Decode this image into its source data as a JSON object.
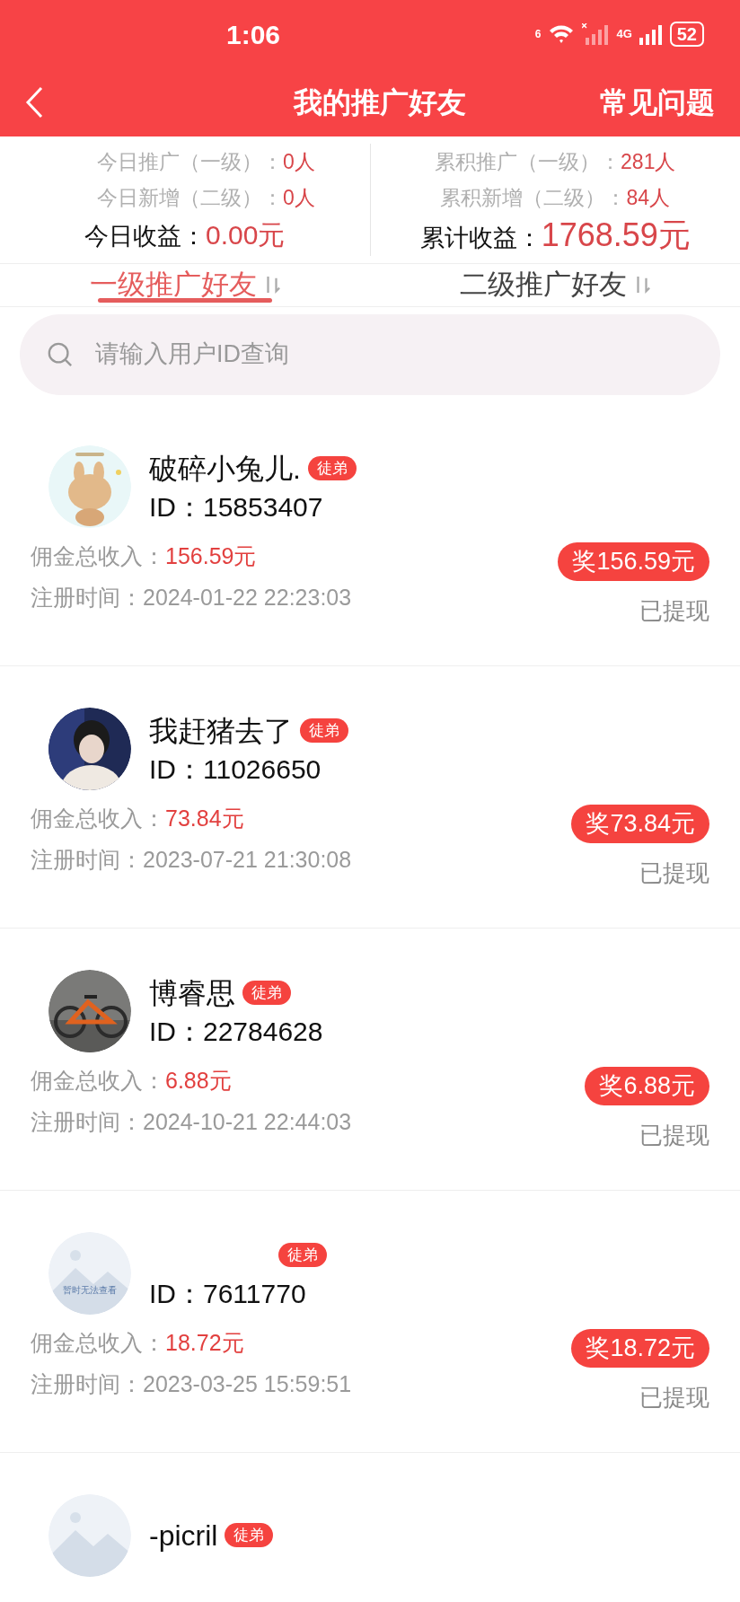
{
  "status_bar": {
    "time": "1:06",
    "wifi_tag": "6",
    "network": "4G",
    "battery": "52"
  },
  "header": {
    "title": "我的推广好友",
    "action": "常见问题"
  },
  "stats": {
    "left": [
      {
        "label": "今日推广（一级）：",
        "value": "0人"
      },
      {
        "label": "今日新增（二级）：",
        "value": "0人"
      }
    ],
    "left_total": {
      "label": "今日收益：",
      "value": "0.00元"
    },
    "right": [
      {
        "label": "累积推广（一级）：",
        "value": "281人"
      },
      {
        "label": "累积新增（二级）：",
        "value": "84人"
      }
    ],
    "right_total": {
      "label": "累计收益：",
      "value": "1768.59元"
    }
  },
  "tabs": [
    {
      "label": "一级推广好友",
      "selected": true
    },
    {
      "label": "二级推广好友",
      "selected": false
    }
  ],
  "search": {
    "placeholder": "请输入用户ID查询"
  },
  "friends": [
    {
      "avatar": {
        "kind": "cartoon"
      },
      "name": "破碎小兔儿.",
      "badge": "徒弟",
      "id_label": "ID：",
      "id": "15853407",
      "income_label": "佣金总收入：",
      "income": "156.59元",
      "time_label": "注册时间：",
      "time": "2024-01-22 22:23:03",
      "reward": "奖156.59元",
      "status": "已提现"
    },
    {
      "name": "我赶猪去了",
      "badge": "徒弟",
      "id_label": "ID：",
      "id": "11026650",
      "income_label": "佣金总收入：",
      "income": "73.84元",
      "time_label": "注册时间：",
      "time": "2023-07-21 21:30:08",
      "reward": "奖73.84元",
      "status": "已提现"
    },
    {
      "avatar": {
        "kind": "bike"
      },
      "name": "博睿思",
      "badge": "徒弟",
      "id_label": "ID：",
      "id": "22784628",
      "income_label": "佣金总收入：",
      "income": "6.88元",
      "time_label": "注册时间：",
      "time": "2024-10-21 22:44:03",
      "reward": "奖6.88元",
      "status": "已提现"
    },
    {
      "avatar": {
        "kind": "placeholder",
        "caption": "暂时无法查看"
      },
      "badge": "徒弟",
      "id_label": "ID：",
      "id": "7611770",
      "income_label": "佣金总收入：",
      "income": "18.72元",
      "time_label": "注册时间：",
      "time": "2023-03-25 15:59:51",
      "reward": "奖18.72元",
      "status": "已提现"
    },
    {
      "avatar": {
        "kind": "placeholder"
      },
      "name": "-picril",
      "badge": "徒弟"
    }
  ]
}
